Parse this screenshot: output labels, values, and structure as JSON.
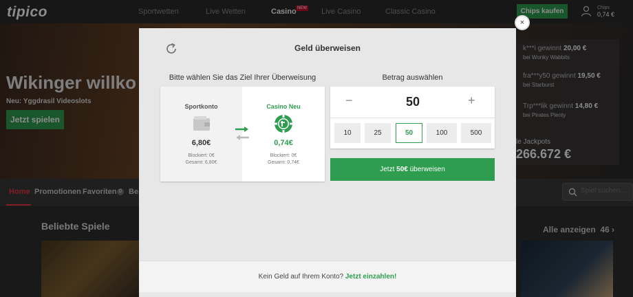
{
  "header": {
    "logo": "tipico",
    "nav": [
      "Sportwetten",
      "Live Wetten",
      "Casino",
      "Live Casino",
      "Classic Casino"
    ],
    "new_badge": "NEW",
    "chips_button": "Chips kaufen",
    "chips_label": "Chips",
    "chips_value": "0,74 €"
  },
  "hero": {
    "title": "Wikinger willko",
    "subtitle": "Neu: Yggdrasil Videoslots",
    "cta": "Jetzt spielen"
  },
  "winners": [
    {
      "user": "k***i",
      "verb": "gewinnt",
      "amount": "20,00 €",
      "game_prefix": "bei",
      "game": "Wonky Wabbits"
    },
    {
      "user": "fra***y50",
      "verb": "gewinnt",
      "amount": "19,50 €",
      "game_prefix": "bei",
      "game": "Starburst"
    },
    {
      "user": "Trp***lik",
      "verb": "gewinnt",
      "amount": "14,80 €",
      "game_prefix": "bei",
      "game": "Pirates Plenty"
    }
  ],
  "jackpot": {
    "label": "le Jackpots",
    "value": "266.672 €"
  },
  "subnav": {
    "items": [
      "Home",
      "Promotionen",
      "Favoriten",
      "Be"
    ],
    "favorites_count": "0",
    "search_placeholder": "Spiel suchen..."
  },
  "games": {
    "title": "Beliebte Spiele",
    "all_label": "Alle anzeigen",
    "all_count": "46"
  },
  "modal": {
    "title": "Geld überweisen",
    "close": "×",
    "target_heading": "Bitte wählen Sie das Ziel Ihrer Überweisung",
    "amount_heading": "Betrag auswählen",
    "source": {
      "name": "Sportkonto",
      "amount": "6,80€",
      "blocked": "Blockiert: 0€",
      "total": "Gesamt: 6,80€"
    },
    "destination": {
      "name": "Casino Neu",
      "amount": "0,74€",
      "blocked": "Blockiert: 0€",
      "total": "Gesamt: 0,74€"
    },
    "amount": {
      "minus": "−",
      "value": "50",
      "plus": "+"
    },
    "presets": [
      "10",
      "25",
      "50",
      "100",
      "500"
    ],
    "selected_preset": "50",
    "transfer_prefix": "Jetzt ",
    "transfer_amount": "50€",
    "transfer_suffix": " überweisen",
    "footer_text": "Kein Geld auf Ihrem Konto?",
    "footer_link": "Jetzt einzahlen!"
  },
  "colors": {
    "accent": "#2e9d4f",
    "home_red": "#e33344",
    "modal_bg": "#e7e7e7"
  }
}
